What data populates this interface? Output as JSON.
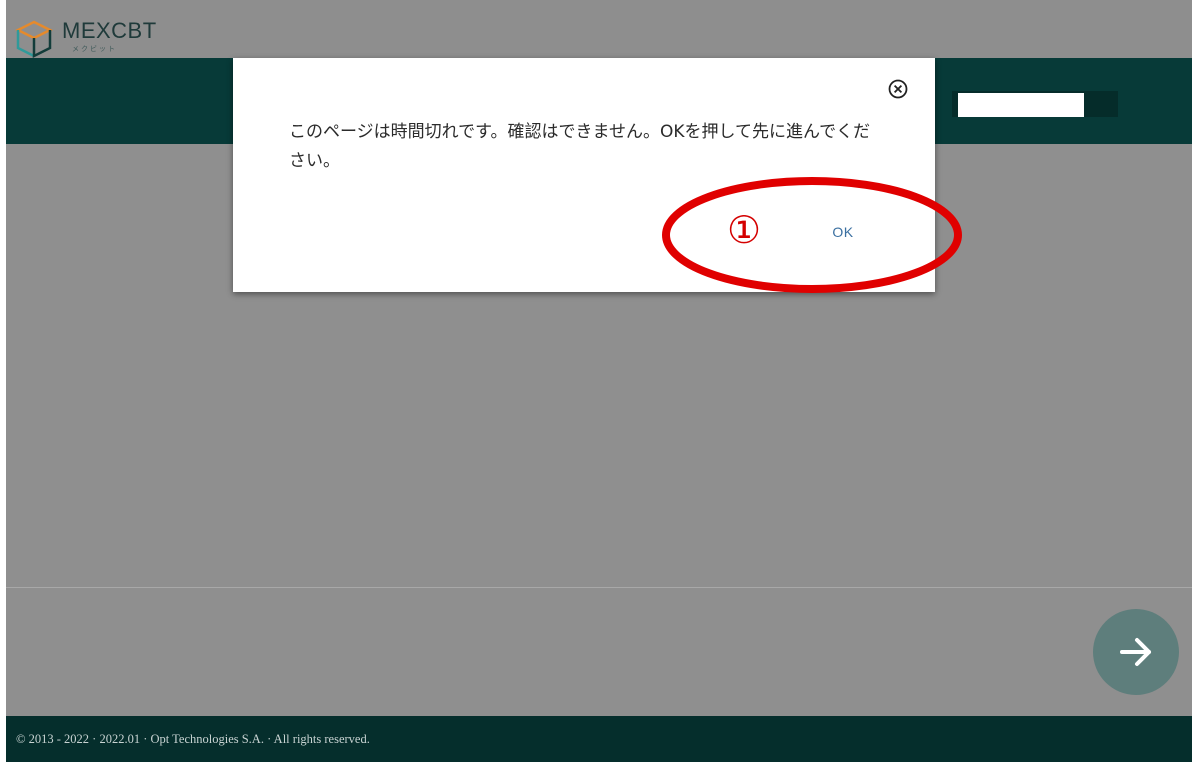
{
  "brand": {
    "name": "MEXCBT",
    "subtitle": "メクビット",
    "logo_colors": [
      "#e58a2c",
      "#2f9a9a",
      "#123c3a"
    ]
  },
  "header": {
    "accent_color": "#073a38",
    "timer_progress": 0.76
  },
  "dialog": {
    "message": "このページは時間切れです。確認はできません。OKを押して先に進んでください。",
    "ok_label": "OK",
    "close_icon": "close-circle-icon"
  },
  "annotation": {
    "step_number": "①",
    "color": "#e00000"
  },
  "navigation": {
    "next_icon": "arrow-right-icon"
  },
  "footer": {
    "text": "© 2013 - 2022 · 2022.01 · Opt Technologies S.A. · All rights reserved."
  }
}
